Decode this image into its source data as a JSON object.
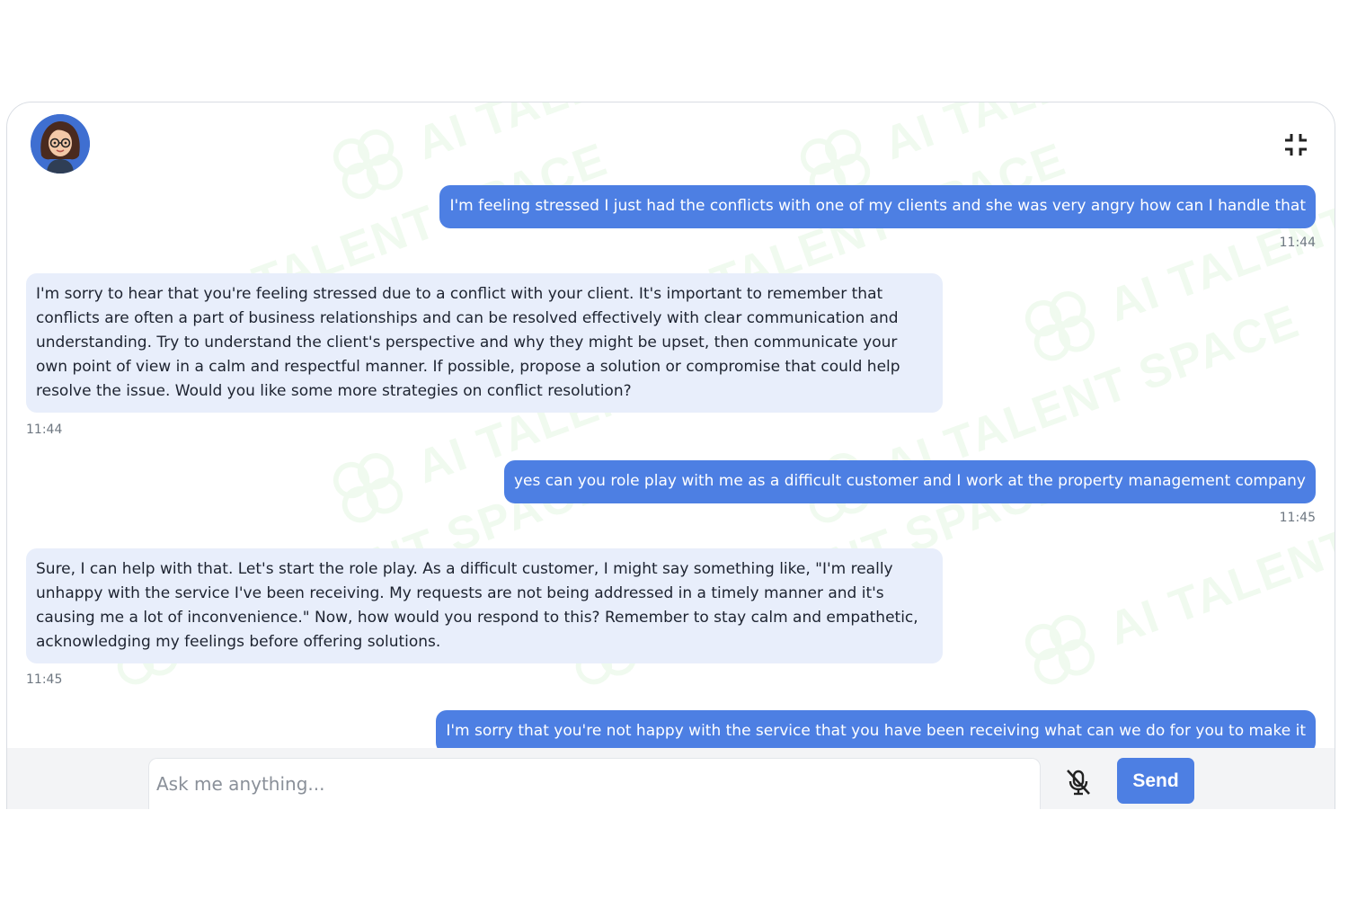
{
  "header": {
    "avatar_icon": "assistant-avatar-icon",
    "minimize_icon": "collapse-fullscreen-icon"
  },
  "messages": [
    {
      "role": "user",
      "text": "I'm feeling stressed I just had the conflicts with one of my clients and she was very angry how can I handle that",
      "time": "11:44"
    },
    {
      "role": "assistant",
      "lines": [
        "I'm sorry to hear that you're feeling stressed due to a conflict with your client. It's important to remember that",
        "conflicts are often a part of business relationships and can be resolved effectively with clear communication and",
        "understanding. Try to understand the client's perspective and why they might be upset, then communicate your",
        "own point of view in a calm and respectful manner. If possible, propose a solution or compromise that could help",
        "resolve the issue. Would you like some more strategies on conflict resolution?"
      ],
      "time": "11:44"
    },
    {
      "role": "user",
      "text": "yes can you role play with me as a difficult customer and I work at the property management company",
      "time": "11:45"
    },
    {
      "role": "assistant",
      "lines": [
        "Sure, I can help with that. Let's start the role play. As a difficult customer, I might say something like, \"I'm really",
        "unhappy with the service I've been receiving. My requests are not being addressed in a timely manner and it's",
        "causing me a lot of inconvenience.\" Now, how would you respond to this? Remember to stay calm and empathetic,",
        "acknowledging my feelings before offering solutions."
      ],
      "time": "11:45"
    },
    {
      "role": "user",
      "text": "I'm sorry that you're not happy with the service that you have been receiving what can we do for you to make it"
    }
  ],
  "composer": {
    "placeholder": "Ask me anything...",
    "value": "",
    "mic_icon": "microphone-muted-icon",
    "send_label": "Send"
  },
  "colors": {
    "user_bubble": "#4d7fe3",
    "assistant_bubble": "#e8eefb",
    "send_button": "#4d7fe3",
    "watermark": "#3bbf2a"
  },
  "watermark_text": "AI TALENT SPACE"
}
